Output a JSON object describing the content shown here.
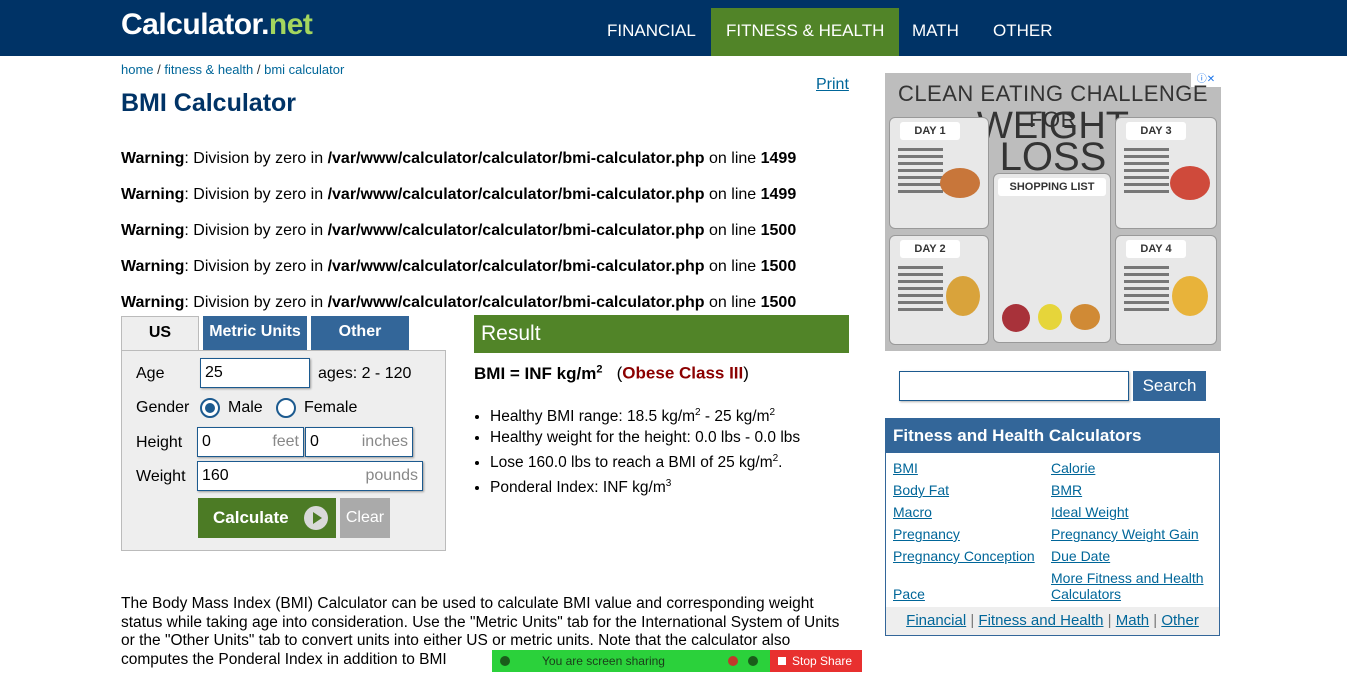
{
  "header": {
    "logo_main": "Calculator",
    "logo_dot": ".",
    "logo_net": "net",
    "nav": [
      "FINANCIAL",
      "FITNESS & HEALTH",
      "MATH",
      "OTHER"
    ],
    "active_nav": "FITNESS & HEALTH",
    "accent": "#003366",
    "active_color": "#518428"
  },
  "breadcrumb": {
    "items": [
      "home",
      "fitness & health",
      "bmi calculator"
    ],
    "sep": " / "
  },
  "page_title": "BMI Calculator",
  "print_label": "Print",
  "warnings": [
    {
      "label": "Warning",
      "msg": ": Division by zero in ",
      "path": "/var/www/calculator/calculator/bmi-calculator.php",
      "on": " on line ",
      "line": "1499"
    },
    {
      "label": "Warning",
      "msg": ": Division by zero in ",
      "path": "/var/www/calculator/calculator/bmi-calculator.php",
      "on": " on line ",
      "line": "1499"
    },
    {
      "label": "Warning",
      "msg": ": Division by zero in ",
      "path": "/var/www/calculator/calculator/bmi-calculator.php",
      "on": " on line ",
      "line": "1500"
    },
    {
      "label": "Warning",
      "msg": ": Division by zero in ",
      "path": "/var/www/calculator/calculator/bmi-calculator.php",
      "on": " on line ",
      "line": "1500"
    },
    {
      "label": "Warning",
      "msg": ": Division by zero in ",
      "path": "/var/www/calculator/calculator/bmi-calculator.php",
      "on": " on line ",
      "line": "1500"
    }
  ],
  "tabs": [
    "US Units",
    "Metric Units",
    "Other Units"
  ],
  "form": {
    "age_label": "Age",
    "age_value": "25",
    "age_hint": "ages: 2 - 120",
    "gender_label": "Gender",
    "gender_options": [
      "Male",
      "Female"
    ],
    "gender_selected": "Male",
    "height_label": "Height",
    "height_feet": "0",
    "height_feet_unit": "feet",
    "height_inches": "0",
    "height_inches_unit": "inches",
    "weight_label": "Weight",
    "weight_value": "160",
    "weight_unit": "pounds",
    "calculate_label": "Calculate",
    "clear_label": "Clear"
  },
  "result": {
    "heading": "Result",
    "bmi_text": "BMI = INF kg/m",
    "bmi_sup": "2",
    "class_open": "(",
    "class_label": "Obese Class III",
    "class_close": ")",
    "list": [
      {
        "a": "Healthy BMI range: 18.5 kg/m",
        "s1": "2",
        "b": " - 25 kg/m",
        "s2": "2",
        "c": ""
      },
      {
        "a": "Healthy weight for the height: 0.0 lbs - 0.0 lbs",
        "s1": "",
        "b": "",
        "s2": "",
        "c": ""
      },
      {
        "a": "Lose 160.0 lbs to reach a BMI of 25 kg/m",
        "s1": "2",
        "b": ".",
        "s2": "",
        "c": ""
      },
      {
        "a": "Ponderal Index: INF kg/m",
        "s1": "3",
        "b": "",
        "s2": "",
        "c": ""
      }
    ]
  },
  "description": "The Body Mass Index (BMI) Calculator can be used to calculate BMI value and corresponding weight status while taking age into consideration. Use the \"Metric Units\" tab for the International System of Units or the \"Other Units\" tab to convert units into either US or metric units. Note that the calculator also computes the Ponderal Index in addition to BMI",
  "ad": {
    "line1": "CLEAN EATING CHALLENGE FOR",
    "line2": "WEIGHT",
    "line3": "LOSS",
    "days": [
      "DAY 1",
      "DAY 2",
      "DAY 3",
      "DAY 4"
    ],
    "shopping": "SHOPPING LIST",
    "info_icon": "adchoices-icon"
  },
  "search": {
    "value": "",
    "button": "Search"
  },
  "sidebar": {
    "heading": "Fitness and Health Calculators",
    "left_links": [
      "BMI",
      "Body Fat",
      "Macro",
      "Pregnancy",
      "Pregnancy Conception",
      "Pace"
    ],
    "right_links": [
      "Calorie",
      "BMR",
      "Ideal Weight",
      "Pregnancy Weight Gain",
      "Due Date",
      "More Fitness and Health",
      "Calculators"
    ],
    "footer_links": [
      "Financial",
      "Fitness and Health",
      "Math",
      "Other"
    ],
    "footer_sep": " | "
  },
  "screen_share": {
    "text": "You are screen sharing",
    "stop": "Stop Share"
  }
}
